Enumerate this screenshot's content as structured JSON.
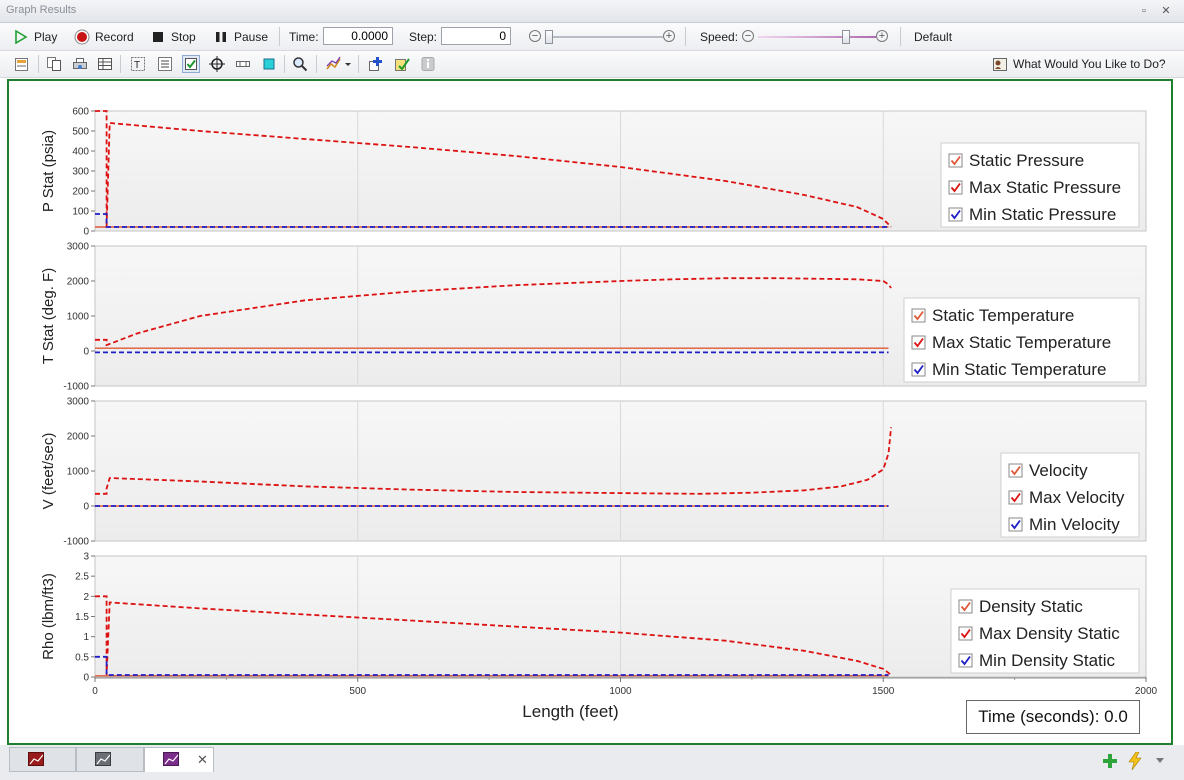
{
  "window": {
    "title": "Graph Results"
  },
  "toolbar": {
    "play": "Play",
    "record": "Record",
    "stop": "Stop",
    "pause": "Pause",
    "time_label": "Time:",
    "time_value": "0.0000",
    "step_label": "Step:",
    "step_value": "0",
    "speed_label": "Speed:",
    "default_label": "Default",
    "help_label": "What Would You Like to Do?"
  },
  "colors": {
    "frame": "#1e7f2e",
    "static": "#e05a3a",
    "max": "#dd1111",
    "min": "#1f1fc8"
  },
  "chart_data": [
    {
      "type": "line",
      "ylabel": "P Stat (psia)",
      "ylim": [
        0,
        600
      ],
      "yticks": [
        "600",
        "500",
        "400",
        "300",
        "200",
        "100",
        "0"
      ],
      "series": [
        {
          "name": "Static Pressure",
          "x": [
            0,
            1510
          ],
          "y": [
            20,
            20
          ]
        },
        {
          "name": "Max Static Pressure",
          "x": [
            0,
            22,
            22,
            28,
            200,
            400,
            600,
            800,
            1000,
            1200,
            1350,
            1450,
            1500,
            1515
          ],
          "y": [
            600,
            600,
            20,
            540,
            500,
            460,
            420,
            375,
            320,
            250,
            180,
            120,
            60,
            20
          ]
        },
        {
          "name": "Min Static Pressure",
          "x": [
            0,
            22,
            22,
            1510
          ],
          "y": [
            85,
            85,
            20,
            20
          ]
        }
      ]
    },
    {
      "type": "line",
      "ylabel": "T Stat (deg. F)",
      "ylim": [
        -1000,
        3000
      ],
      "yticks": [
        "3000",
        "2000",
        "1000",
        "0",
        "-1000"
      ],
      "series": [
        {
          "name": "Static Temperature",
          "x": [
            0,
            1510
          ],
          "y": [
            80,
            80
          ]
        },
        {
          "name": "Max Static Temperature",
          "x": [
            0,
            22,
            22,
            80,
            200,
            400,
            600,
            800,
            1000,
            1100,
            1200,
            1300,
            1450,
            1500,
            1510,
            1515
          ],
          "y": [
            320,
            320,
            170,
            500,
            1000,
            1450,
            1700,
            1880,
            2000,
            2050,
            2080,
            2080,
            2050,
            2000,
            1900,
            1800
          ]
        },
        {
          "name": "Min Static Temperature",
          "x": [
            0,
            1510
          ],
          "y": [
            -40,
            -40
          ]
        }
      ]
    },
    {
      "type": "line",
      "ylabel": "V (feet/sec)",
      "ylim": [
        -1000,
        3000
      ],
      "yticks": [
        "3000",
        "2000",
        "1000",
        "0",
        "-1000"
      ],
      "series": [
        {
          "name": "Velocity",
          "x": [
            0,
            1510
          ],
          "y": [
            0,
            0
          ]
        },
        {
          "name": "Max Velocity",
          "x": [
            0,
            22,
            22,
            28,
            200,
            400,
            600,
            800,
            1000,
            1150,
            1250,
            1350,
            1420,
            1470,
            1500,
            1510,
            1515
          ],
          "y": [
            350,
            350,
            500,
            800,
            700,
            560,
            470,
            400,
            370,
            350,
            380,
            450,
            560,
            750,
            1050,
            1500,
            2250
          ]
        },
        {
          "name": "Min Velocity",
          "x": [
            0,
            1510
          ],
          "y": [
            0,
            0
          ]
        }
      ]
    },
    {
      "type": "line",
      "ylabel": "Rho (lbm/ft3)",
      "ylim": [
        0,
        3
      ],
      "yticks": [
        "3",
        "2.5",
        "2",
        "1.5",
        "1",
        "0.5",
        "0"
      ],
      "series": [
        {
          "name": "Density Static",
          "x": [
            0,
            1510
          ],
          "y": [
            0.03,
            0.03
          ]
        },
        {
          "name": "Max Density Static",
          "x": [
            0,
            22,
            22,
            28,
            200,
            400,
            600,
            800,
            1000,
            1200,
            1350,
            1450,
            1500,
            1515
          ],
          "y": [
            2.0,
            2.0,
            0.05,
            1.85,
            1.7,
            1.55,
            1.4,
            1.25,
            1.1,
            0.9,
            0.65,
            0.4,
            0.2,
            0.05
          ]
        },
        {
          "name": "Min Density Static",
          "x": [
            0,
            22,
            22,
            1510
          ],
          "y": [
            0.5,
            0.5,
            0.05,
            0.05
          ]
        }
      ]
    }
  ],
  "x_axis": {
    "label": "Length (feet)",
    "ticks": [
      "0",
      "500",
      "1000",
      "1500",
      "2000"
    ],
    "xlim": [
      0,
      2000
    ]
  },
  "time_box": "Time (seconds): 0.0"
}
